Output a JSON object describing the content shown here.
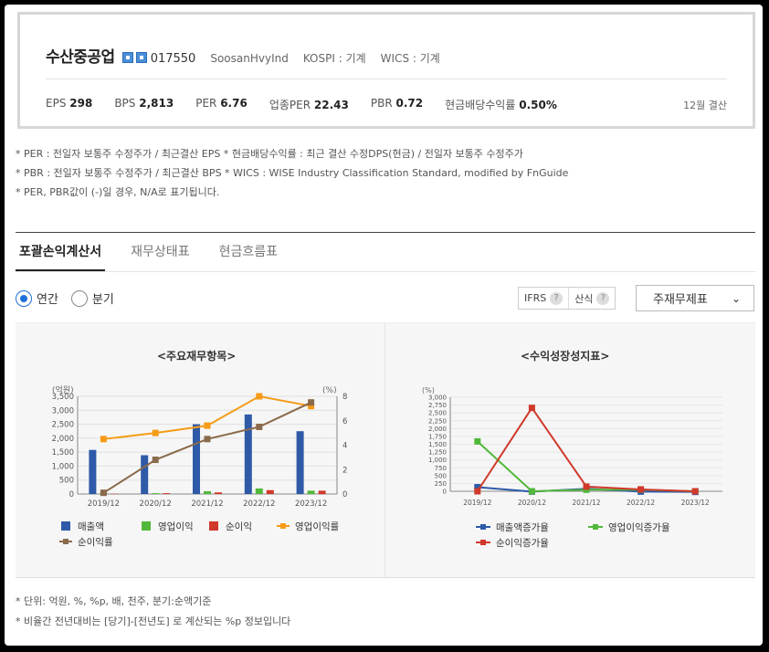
{
  "company": {
    "name": "수산중공업",
    "code": "017550",
    "english_name": "SoosanHvyInd",
    "market": "KOSPI : 기계",
    "wics": "WICS : 기계"
  },
  "metrics": [
    {
      "label": "EPS",
      "value": "298"
    },
    {
      "label": "BPS",
      "value": "2,813"
    },
    {
      "label": "PER",
      "value": "6.76"
    },
    {
      "label": "업종PER",
      "value": "22.43"
    },
    {
      "label": "PBR",
      "value": "0.72"
    },
    {
      "label": "현금배당수익률",
      "value": "0.50%"
    }
  ],
  "fiscal_note": "12월 결산",
  "notes": [
    "* PER : 전일자 보통주 수정주가 / 최근결산 EPS * 현금배당수익률 : 최근 결산 수정DPS(현금) / 전일자 보통주 수정주가",
    "* PBR : 전일자 보통주 수정주가 / 최근결산 BPS * WICS : WISE Industry Classification Standard, modified by FnGuide",
    "* PER, PBR값이 (-)일 경우, N/A로 표기됩니다."
  ],
  "tabs": [
    "포괄손익계산서",
    "재무상태표",
    "현금흐름표"
  ],
  "period": {
    "annual": "연간",
    "quarterly": "분기"
  },
  "toggles": {
    "ifrs": "IFRS",
    "calc": "산식",
    "help": "?"
  },
  "select": {
    "value": "주재무제표"
  },
  "colors": {
    "revenue": "#2e5aa8",
    "op_income": "#52b83a",
    "net_income": "#d0392b",
    "op_margin": "#f59b16",
    "net_margin": "#8a6a4a"
  },
  "chart_data": [
    {
      "type": "bar",
      "title": "<주요재무항목>",
      "categories": [
        "2019/12",
        "2020/12",
        "2021/12",
        "2022/12",
        "2023/12"
      ],
      "y_left_unit": "(억원)",
      "y_right_unit": "(%)",
      "ylim_left": [
        0,
        3500
      ],
      "ylim_right": [
        0,
        8
      ],
      "y_left_ticks": [
        "0",
        "500",
        "1,000",
        "1,500",
        "2,000",
        "2,500",
        "3,000",
        "3,500"
      ],
      "y_right_ticks": [
        "0",
        "2",
        "4",
        "6",
        "8"
      ],
      "series": [
        {
          "name": "매출액",
          "kind": "bar",
          "axis": "left",
          "values": [
            1580,
            1390,
            2500,
            2850,
            2250
          ]
        },
        {
          "name": "영업이익",
          "kind": "bar",
          "axis": "left",
          "values": [
            40,
            30,
            100,
            200,
            120
          ]
        },
        {
          "name": "순이익",
          "kind": "bar",
          "axis": "left",
          "values": [
            10,
            30,
            60,
            140,
            120
          ]
        },
        {
          "name": "영업이익률",
          "kind": "line",
          "axis": "right",
          "values": [
            4.5,
            5.0,
            5.6,
            8.0,
            7.2
          ]
        },
        {
          "name": "순이익률",
          "kind": "line",
          "axis": "right",
          "values": [
            0.1,
            2.8,
            4.5,
            5.5,
            7.5
          ]
        }
      ]
    },
    {
      "type": "line",
      "title": "<수익성장성지표>",
      "categories": [
        "2019/12",
        "2020/12",
        "2021/12",
        "2022/12",
        "2023/12"
      ],
      "y_unit": "(%)",
      "ylim": [
        0,
        3000
      ],
      "y_ticks": [
        "0",
        "250",
        "500",
        "750",
        "1,000",
        "1,250",
        "1,500",
        "1,750",
        "2,000",
        "2,250",
        "2,500",
        "2,750",
        "3,000"
      ],
      "series": [
        {
          "name": "매출액증가율",
          "values": [
            130,
            -10,
            80,
            -10,
            -20
          ]
        },
        {
          "name": "영업이익증가율",
          "values": [
            1590,
            0,
            50,
            50,
            0
          ]
        },
        {
          "name": "순이익증가율",
          "values": [
            0,
            2660,
            150,
            60,
            0
          ]
        }
      ]
    }
  ],
  "units_notes": [
    "* 단위: 억원, %, %p, 배, 천주, 분기:순액기준",
    "* 비율간 전년대비는 [당기]-[전년도] 로 계산되는 %p 정보입니다"
  ]
}
